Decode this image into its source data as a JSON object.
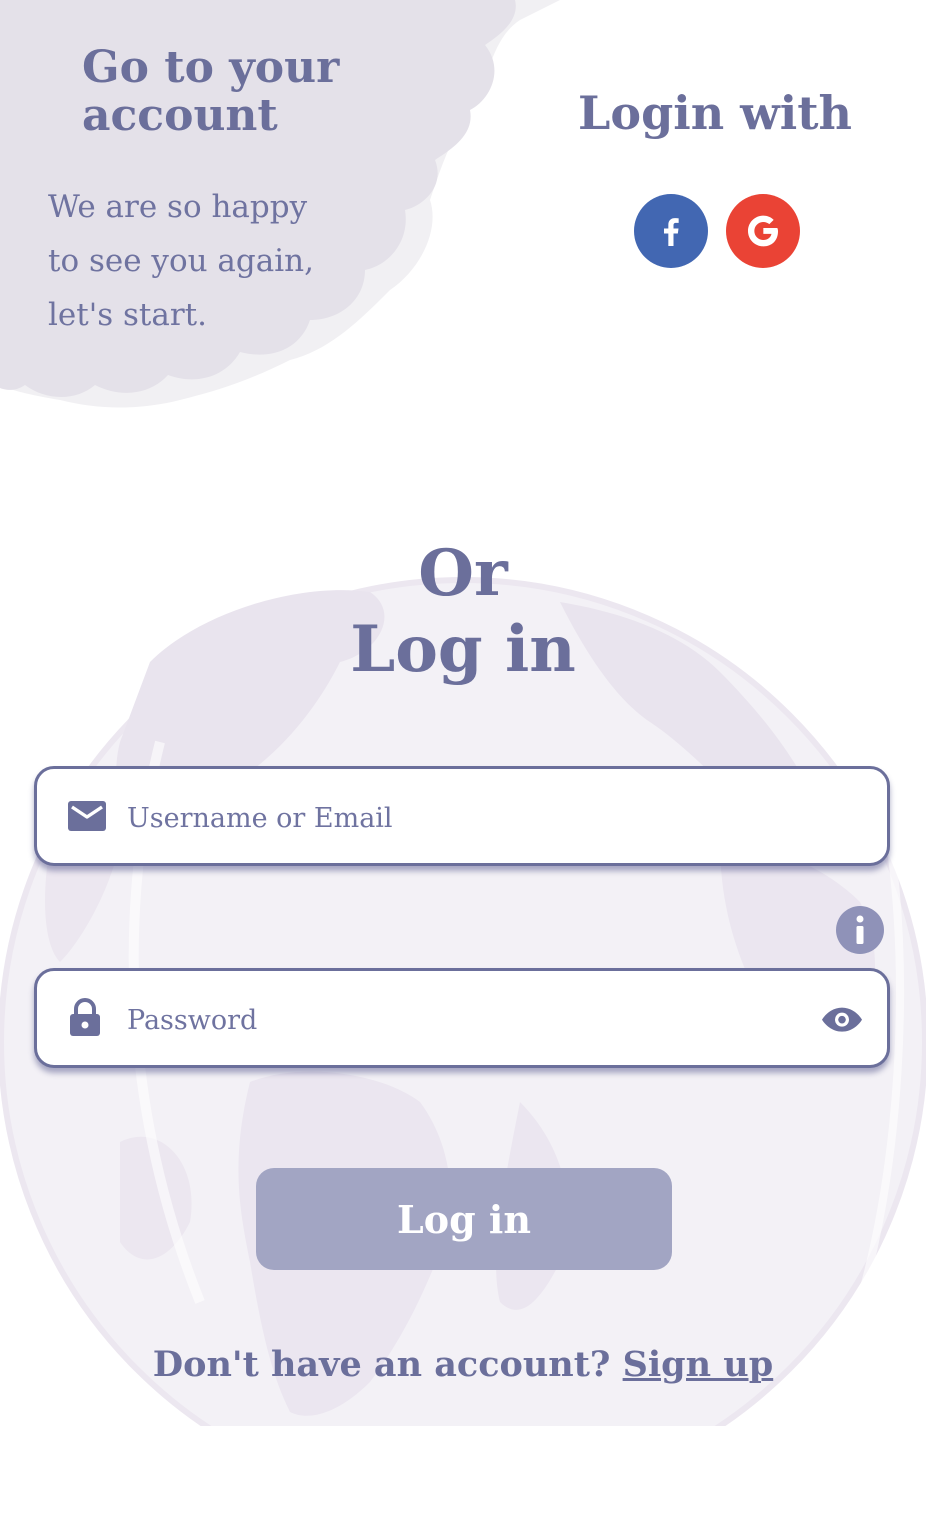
{
  "welcome": {
    "title": "Go to your account",
    "text": "We are so happy to see you again, let's start."
  },
  "social": {
    "heading": "Login with",
    "facebook_icon": "facebook-icon",
    "google_icon": "google-icon",
    "facebook_color": "#4267b2",
    "google_color": "#ea4335"
  },
  "form": {
    "heading_line1": "Or",
    "heading_line2": "Log in",
    "username": {
      "placeholder": "Username or Email",
      "value": "",
      "icon": "mail-icon"
    },
    "password": {
      "placeholder": "Password",
      "value": "",
      "icon": "lock-icon",
      "toggle_icon": "eye-icon"
    },
    "info_icon": "info-icon",
    "submit_label": "Log in"
  },
  "footer": {
    "prompt": "Don't have an account?",
    "signup_label": "Sign up"
  },
  "colors": {
    "primary": "#6b6f9b",
    "button": "#a2a5c3",
    "cloud": "#e4e1e9",
    "globe": "#f1eef4"
  }
}
